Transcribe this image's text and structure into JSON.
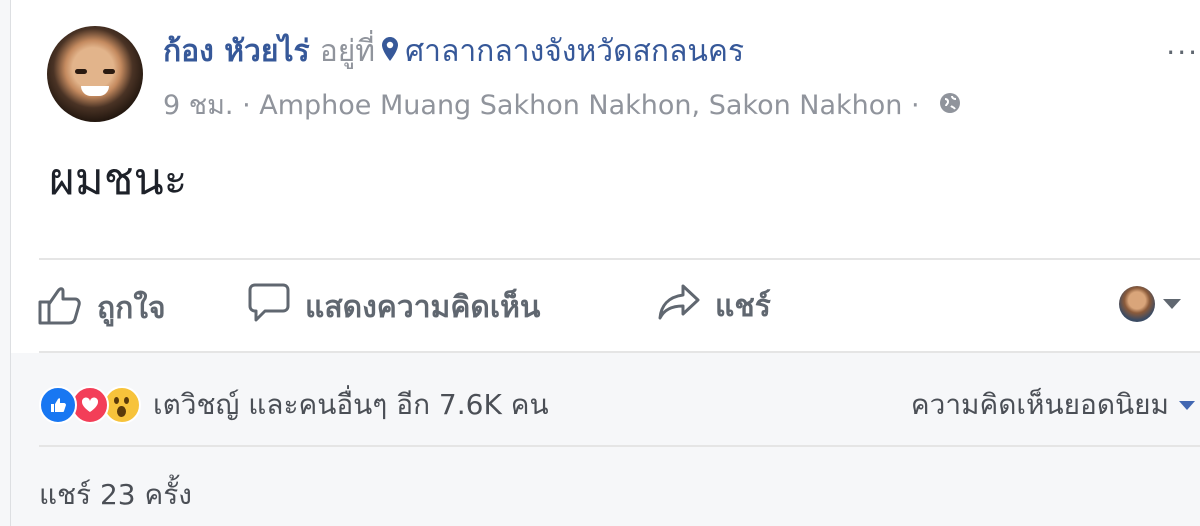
{
  "post": {
    "author": "ก้อง หัวยไร่",
    "at_label": "อยู่ที่",
    "place": "ศาลากลางจังหวัดสกลนคร",
    "time": "9 ชม.",
    "separator": "·",
    "location": "Amphoe Muang Sakhon Nakhon, Sakon Nakhon",
    "text": "ผมชนะ",
    "more_label": "···",
    "privacy_icon": "globe-icon"
  },
  "actions": {
    "like_label": "ถูกใจ",
    "comment_label": "แสดงความคิดเห็น",
    "share_label": "แชร์"
  },
  "reactions": {
    "icons": [
      "like-icon",
      "love-icon",
      "wow-icon"
    ],
    "summary": "เตวิชญ์ และคนอื่นๆ อีก 7.6K คน"
  },
  "comments_filter": {
    "label": "ความคิดเห็นยอดนิยม"
  },
  "shares": {
    "label": "แชร์ 23 ครั้ง"
  },
  "colors": {
    "link": "#365899",
    "meta": "#90949c",
    "like": "#1877f2",
    "love": "#f33e58",
    "wow": "#f7c33b"
  }
}
